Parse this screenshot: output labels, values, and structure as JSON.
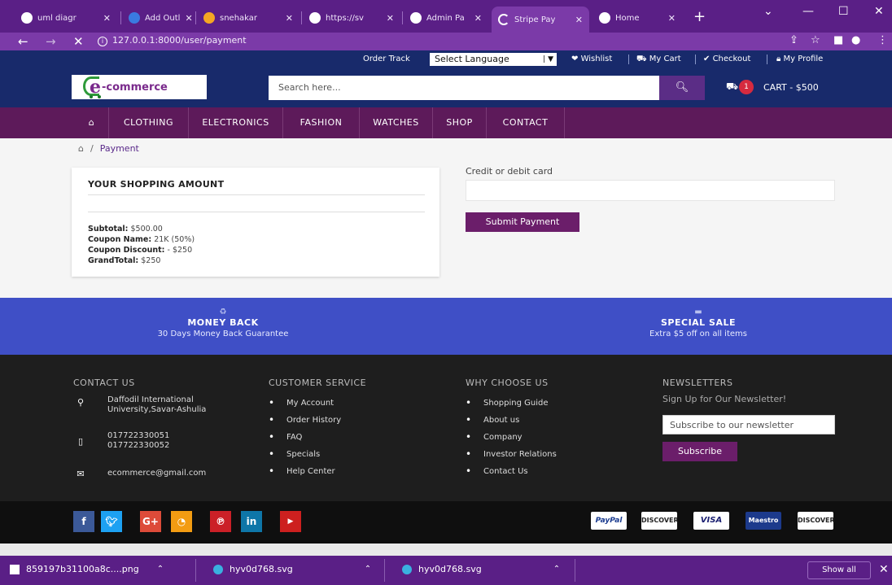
{
  "browser": {
    "tabs": [
      {
        "label": "uml diagr",
        "icon": "google-icon"
      },
      {
        "label": "Add Outl",
        "icon": "outline-icon"
      },
      {
        "label": "snehakar",
        "icon": "cloud-icon"
      },
      {
        "label": "https://sv",
        "icon": "globe-icon"
      },
      {
        "label": "Admin Pa",
        "icon": "globe-icon"
      },
      {
        "label": "Stripe Pay",
        "icon": "loading-icon"
      },
      {
        "label": "Home",
        "icon": "globe-icon"
      }
    ],
    "url": "127.0.0.1:8000/user/payment"
  },
  "topbar": {
    "order_track": "Order Track",
    "language": "Select Language",
    "wishlist": "Wishlist",
    "my_cart": "My Cart",
    "checkout": "Checkout",
    "my_profile": "My Profile"
  },
  "header": {
    "logo_e": "e",
    "logo_text": "-commerce",
    "search_placeholder": "Search here...",
    "cart_count": "1",
    "cart_label": "CART - $500"
  },
  "menu": [
    "CLOTHING",
    "ELECTRONICS",
    "FASHION",
    "WATCHES",
    "SHOP",
    "CONTACT"
  ],
  "breadcrumb": {
    "sep": "/",
    "current": "Payment"
  },
  "summary": {
    "title": "YOUR SHOPPING AMOUNT",
    "subtotal_label": "Subtotal:",
    "subtotal_value": "$500.00",
    "coupon_name_label": "Coupon Name:",
    "coupon_name_value": "21K (50%)",
    "coupon_discount_label": "Coupon Discount:",
    "coupon_discount_value": "- $250",
    "grandtotal_label": "GrandTotal:",
    "grandtotal_value": "$250"
  },
  "payment": {
    "card_label": "Credit or debit card",
    "submit": "Submit Payment"
  },
  "promo": [
    {
      "title": "MONEY BACK",
      "subtitle": "30 Days Money Back Guarantee"
    },
    {
      "title": "SPECIAL SALE",
      "subtitle": "Extra $5 off on all items"
    }
  ],
  "footer": {
    "contact_title": "CONTACT US",
    "address_1": "Daffodil International",
    "address_2": "University,Savar-Ashulia",
    "phone_1": "017722330051",
    "phone_2": "017722330052",
    "email": "ecommerce@gmail.com",
    "service_title": "CUSTOMER SERVICE",
    "service_links": [
      "My Account",
      "Order History",
      "FAQ",
      "Specials",
      "Help Center"
    ],
    "why_title": "WHY CHOOSE US",
    "why_links": [
      "Shopping Guide",
      "About us",
      "Company",
      "Investor Relations",
      "Contact Us"
    ],
    "news_title": "NEWSLETTERS",
    "news_subtitle": "Sign Up for Our Newsletter!",
    "news_placeholder": "Subscribe to our newsletter",
    "news_button": "Subscribe"
  },
  "social": [
    "f",
    "t",
    "G+",
    "rss",
    "p",
    "in",
    "yt"
  ],
  "payments": [
    "PayPal",
    "DISCOVER",
    "VISA",
    "Maestro",
    "DISCOVER"
  ],
  "downloads": {
    "items": [
      "859197b31100a8c....png",
      "hyv0d768.svg",
      "hyv0d768.svg"
    ],
    "show_all": "Show all"
  },
  "colors": {
    "navy": "#182a6b",
    "purple": "#5d1a5a",
    "promo_blue": "#3f4fc6",
    "browser_purple": "#5a1f86"
  }
}
